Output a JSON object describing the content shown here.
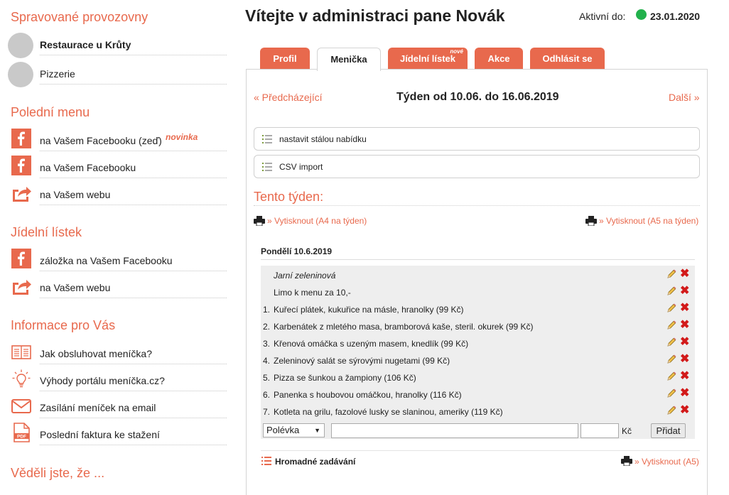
{
  "sidebar": {
    "provozovny_title": "Spravované provozovny",
    "provozovny": [
      {
        "label": "Restaurace u Krůty",
        "bold": true
      },
      {
        "label": "Pizzerie",
        "bold": false
      }
    ],
    "polední_title": "Polední menu",
    "polední_items": [
      {
        "label": "na Vašem Facebooku (zeď)",
        "badge": "novinka",
        "icon": "facebook-icon"
      },
      {
        "label": "na Vašem Facebooku",
        "icon": "facebook-icon"
      },
      {
        "label": "na Vašem webu",
        "icon": "share-icon"
      }
    ],
    "jidelni_title": "Jídelní lístek",
    "jidelni_items": [
      {
        "label": "záložka na Vašem Facebooku",
        "icon": "facebook-icon"
      },
      {
        "label": "na Vašem webu",
        "icon": "share-icon"
      }
    ],
    "info_title": "Informace pro Vás",
    "info_items": [
      {
        "label": "Jak obsluhovat meníčka?",
        "icon": "manual-icon"
      },
      {
        "label": "Výhody portálu meníčka.cz?",
        "icon": "lightbulb-icon"
      },
      {
        "label": "Zasílání meníček na email",
        "icon": "email-icon"
      },
      {
        "label": "Poslední faktura ke stažení",
        "icon": "pdf-icon"
      }
    ],
    "vedeli_title": "Věděli jste, že ..."
  },
  "header": {
    "title": "Vítejte v administraci pane Novák",
    "active_label": "Aktivní do:",
    "active_date": "23.01.2020",
    "status_color": "#22b14c"
  },
  "tabs": [
    {
      "label": "Profil",
      "active": false
    },
    {
      "label": "Menička",
      "active": true
    },
    {
      "label": "Jídelní lístek",
      "badge": "nové",
      "active": false
    },
    {
      "label": "Akce",
      "active": false
    },
    {
      "label": "Odhlásit se",
      "active": false
    }
  ],
  "week": {
    "prev": "« Předcházející",
    "title": "Týden od 10.06. do 16.06.2019",
    "next": "Další »"
  },
  "actions": [
    {
      "label": "nastavit stálou nabídku"
    },
    {
      "label": "CSV import"
    }
  ],
  "this_week_title": "Tento týden:",
  "print": {
    "a4": "» Vytisknout (A4 na týden)",
    "a5": "» Vytisknout (A5 na týden)",
    "a5_day": "» Vytisknout (A5)"
  },
  "day": {
    "title": "Pondělí 10.6.2019",
    "items": [
      {
        "num": "",
        "text": "Jarní zeleninová",
        "italic": true
      },
      {
        "num": "",
        "text": "Limo k menu za 10,-",
        "italic": false
      },
      {
        "num": "1.",
        "text": "Kuřecí plátek, kukuřice na másle, hranolky (99 Kč)"
      },
      {
        "num": "2.",
        "text": "Karbenátek z mletého masa, bramborová kaše, steril. okurek (99 Kč)"
      },
      {
        "num": "3.",
        "text": "Křenová omáčka s uzeným masem, knedlík (99 Kč)"
      },
      {
        "num": "4.",
        "text": "Zeleninový salát se sýrovými nugetami (99 Kč)"
      },
      {
        "num": "5.",
        "text": "Pizza se šunkou a žampiony (106 Kč)"
      },
      {
        "num": "6.",
        "text": "Panenka s houbovou omáčkou, hranolky (116 Kč)"
      },
      {
        "num": "7.",
        "text": "Kotleta na grilu, fazolové lusky se slaninou, ameriky (119 Kč)"
      }
    ],
    "form": {
      "type_selected": "Polévka",
      "currency": "Kč",
      "add_label": "Přidat"
    }
  },
  "bulk_label": "Hromadné zadávání",
  "colors": {
    "accent": "#e8694d",
    "delete": "#d21a1a",
    "facebook": "#e8694d"
  }
}
